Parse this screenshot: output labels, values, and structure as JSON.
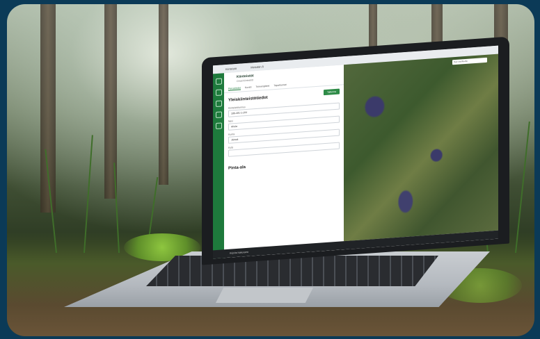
{
  "scene": "laptop on forest moss",
  "browser": {
    "tab_title": "Kiinteistö",
    "address": "Metsään.fi"
  },
  "app": {
    "name": "Kiinteistöt",
    "subtitle": "Omat kiinteistöt",
    "tabs": [
      "Perustiedot",
      "Kuviot",
      "Toimenpiteet",
      "Tapahtumat"
    ],
    "section_title": "Yleiskiinteistötiedot",
    "save_label": "Tallenna",
    "fields": [
      {
        "label": "Kiinteistötunnus",
        "value": "186-401-1-204"
      },
      {
        "label": "Nimi",
        "value": "Ahola"
      },
      {
        "label": "Kunta",
        "value": "Jämsä"
      },
      {
        "label": "Kylä",
        "value": ""
      }
    ],
    "section2_title": "Pinta-ala"
  },
  "map": {
    "search_placeholder": "Hae osoitteella"
  },
  "taskbar": {
    "search_placeholder": "Kirjoita hakusana"
  }
}
